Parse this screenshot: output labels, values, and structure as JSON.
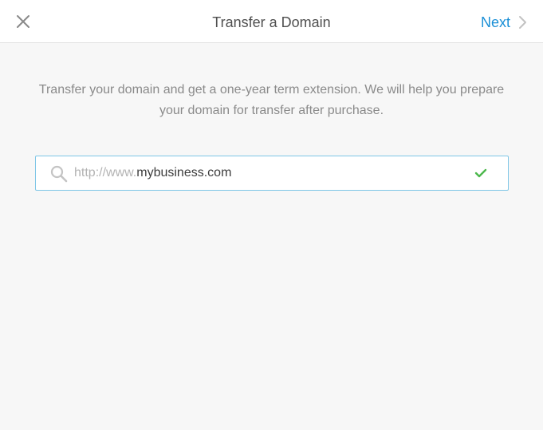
{
  "dialog": {
    "title": "Transfer a Domain",
    "next_label": "Next",
    "description": "Transfer your domain and get a one-year term extension. We will help you prepare your domain for transfer after purchase."
  },
  "search": {
    "prefix": "http://www.",
    "value": "mybusiness.com",
    "status": "valid"
  },
  "icons": {
    "close": "close-icon",
    "next": "chevron-right-icon",
    "search": "search-icon",
    "valid": "checkmark-icon"
  },
  "colors": {
    "accent": "#1a8fd6",
    "valid": "#4cb84c",
    "input_border": "#7ec6e6",
    "title": "#4f4f4f",
    "body_text": "#8a8a8a",
    "background": "#f7f7f7"
  }
}
